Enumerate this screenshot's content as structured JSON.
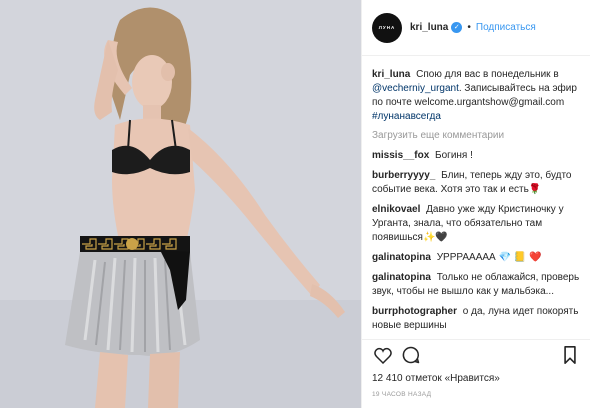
{
  "header": {
    "avatar_text": "ЛУНА",
    "username": "kri_luna",
    "separator": "•",
    "follow_label": "Подписаться"
  },
  "caption": {
    "user": "kri_luna",
    "text_1": "Спою для вас в понедельник в",
    "mention": "@vecherniy_urgant",
    "text_2": ". Записывайтесь на эфир по почте welcome.urgantshow@gmail.com",
    "hashtag": "#лунанавсегда"
  },
  "load_more_label": "Загрузить еще комментарии",
  "comments": [
    {
      "user": "missis__fox",
      "text": "Богиня !"
    },
    {
      "user": "burberryyyy_",
      "text": "Блин, теперь жду это, будто событие века. Хотя это так и есть🌹"
    },
    {
      "user": "elnikovael",
      "text": "Давно уже жду Кристиночку у Урганта, знала, что обязательно там появишься✨🖤"
    },
    {
      "user": "galinatopina",
      "text": "УРРРААААА 💎 📒 ❤️"
    },
    {
      "user": "galinatopina",
      "text": "Только не облажайся, проверь звук, чтобы не вышло как у мальбэка..."
    },
    {
      "user": "burrphotographer",
      "text": "о да, луна идет покорять новые вершины"
    }
  ],
  "likes_text": "12 410 отметок «Нравится»",
  "time_text": "19 ЧАСОВ НАЗАД",
  "icons": [
    "heart-icon",
    "comment-icon",
    "bookmark-icon",
    "verified-badge-icon"
  ],
  "colors": {
    "link_blue": "#3897f0",
    "mention_blue": "#003569",
    "muted": "#999999",
    "text": "#262626"
  }
}
